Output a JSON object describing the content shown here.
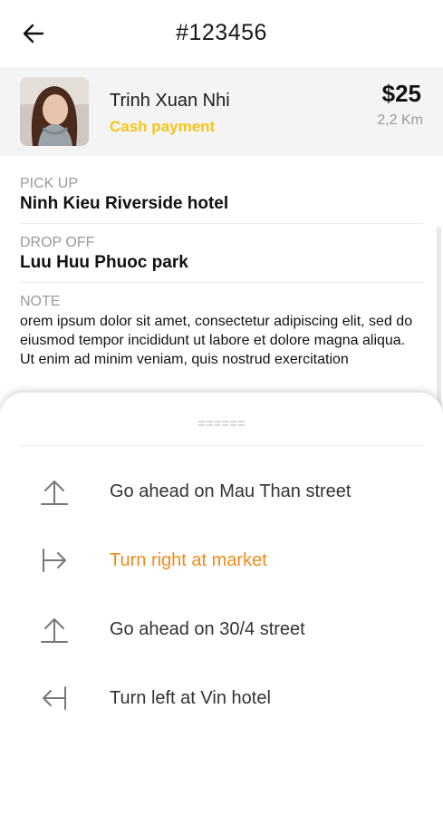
{
  "header": {
    "title": "#123456"
  },
  "driver": {
    "name": "Trinh Xuan Nhi",
    "payment": "Cash payment",
    "price": "$25",
    "distance": "2,2 Km"
  },
  "trip": {
    "pickup_label": "PICK UP",
    "pickup_value": "Ninh Kieu Riverside hotel",
    "dropoff_label": "DROP OFF",
    "dropoff_value": "Luu Huu Phuoc park",
    "note_label": "NOTE",
    "note_text": "orem ipsum dolor sit amet, consectetur adipiscing elit, sed do eiusmod tempor incididunt ut labore et dolore magna aliqua. Ut enim ad minim veniam, quis nostrud exercitation"
  },
  "sheet": {
    "handle": "======",
    "steps": [
      {
        "icon": "arrow-up-icon",
        "text": "Go ahead on Mau Than street",
        "active": false
      },
      {
        "icon": "turn-right-icon",
        "text": "Turn right at market",
        "active": true
      },
      {
        "icon": "arrow-up-icon",
        "text": "Go ahead on 30/4 street",
        "active": false
      },
      {
        "icon": "turn-left-icon",
        "text": "Turn left at Vin hotel",
        "active": false
      }
    ]
  },
  "colors": {
    "accent_yellow": "#f5c518",
    "active_orange": "#f18b1b"
  }
}
